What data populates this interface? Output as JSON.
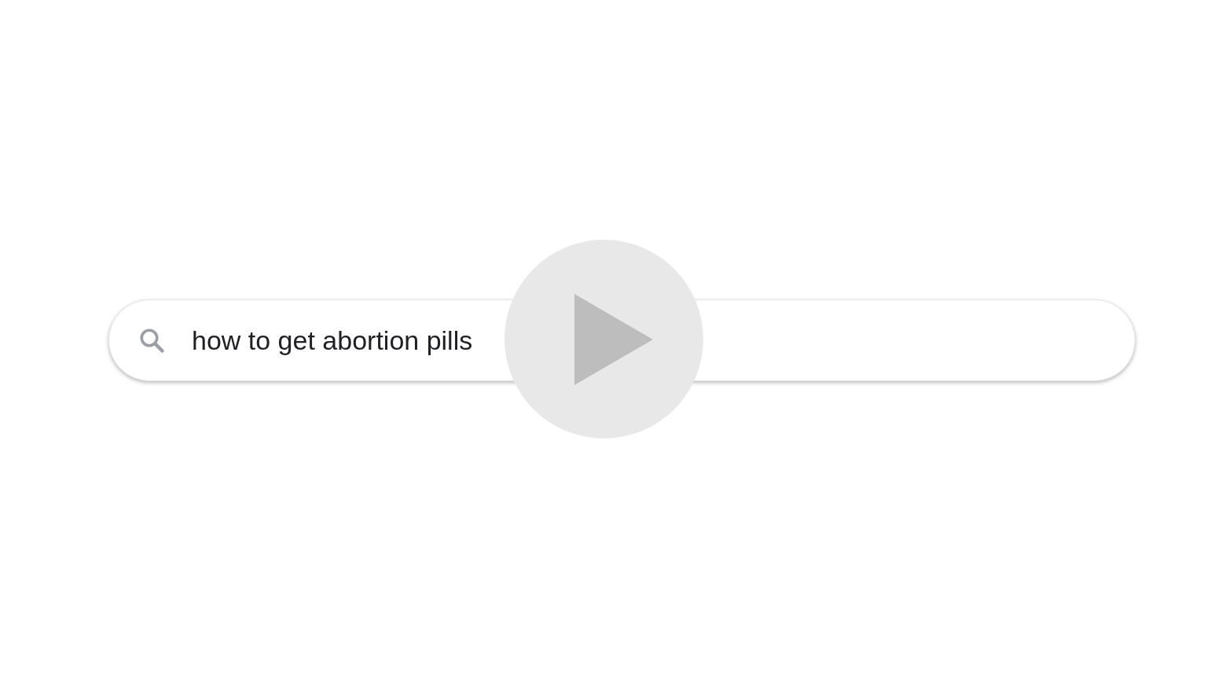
{
  "search": {
    "value": "how to get abortion pills"
  }
}
